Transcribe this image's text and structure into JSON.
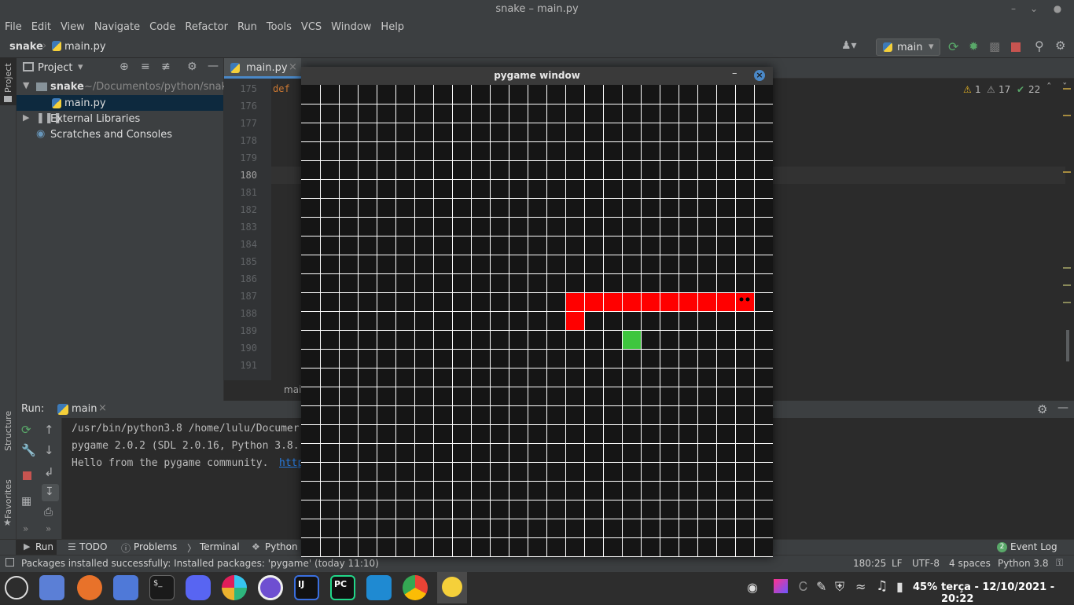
{
  "window": {
    "title": "snake – main.py"
  },
  "menu": [
    "File",
    "Edit",
    "View",
    "Navigate",
    "Code",
    "Refactor",
    "Run",
    "Tools",
    "VCS",
    "Window",
    "Help"
  ],
  "breadcrumb": {
    "project": "snake",
    "file": "main.py"
  },
  "run_config": {
    "name": "main"
  },
  "project_panel": {
    "title": "Project",
    "tree": [
      {
        "label": "snake",
        "path": "~/Documentos/python/snake"
      },
      {
        "label": "main.py"
      },
      {
        "label": "External Libraries"
      },
      {
        "label": "Scratches and Consoles"
      }
    ]
  },
  "side_tabs": {
    "project": "Project",
    "structure": "Structure",
    "favorites": "Favorites"
  },
  "editor": {
    "tab": "main.py",
    "line_numbers": [
      "175",
      "176",
      "177",
      "178",
      "179",
      "180",
      "181",
      "182",
      "183",
      "184",
      "185",
      "186",
      "187",
      "188",
      "189",
      "190",
      "191"
    ],
    "first_line_code": "def",
    "inspections": {
      "warnings": "1",
      "weak_warnings": "17",
      "ok": "22"
    },
    "breadcrumb_text": "mai"
  },
  "run_panel": {
    "label": "Run:",
    "tab": "main",
    "lines": [
      "/usr/bin/python3.8 /home/lulu/Documer",
      "pygame 2.0.2 (SDL 2.0.16, Python 3.8.",
      "Hello from the pygame community. "
    ],
    "link": "http"
  },
  "bottom_tools": {
    "run": "Run",
    "todo": "TODO",
    "problems": "Problems",
    "terminal": "Terminal",
    "python_packages": "Python Pa",
    "event_log": "Event Log",
    "event_count": "2"
  },
  "status": {
    "message": "Packages installed successfully: Installed packages: 'pygame' (today 11:10)",
    "position": "180:25",
    "line_sep": "LF",
    "encoding": "UTF-8",
    "indent": "4 spaces",
    "interpreter": "Python 3.8"
  },
  "pygame": {
    "title": "pygame window",
    "grid_cols": 25,
    "grid_rows": 25,
    "snake_cells": [
      [
        14,
        11
      ],
      [
        15,
        11
      ],
      [
        16,
        11
      ],
      [
        17,
        11
      ],
      [
        18,
        11
      ],
      [
        19,
        11
      ],
      [
        20,
        11
      ],
      [
        21,
        11
      ],
      [
        22,
        11
      ],
      [
        14,
        12
      ]
    ],
    "head_cell": [
      23,
      11
    ],
    "food_cell": [
      17,
      13
    ],
    "snake_color": "#ff0000",
    "food_color": "#3ec63e",
    "bg_color": "#151515",
    "grid_color": "#ffffff"
  },
  "taskbar": {
    "battery": "45%",
    "clock": "terça - 12/10/2021 - 20:22"
  }
}
